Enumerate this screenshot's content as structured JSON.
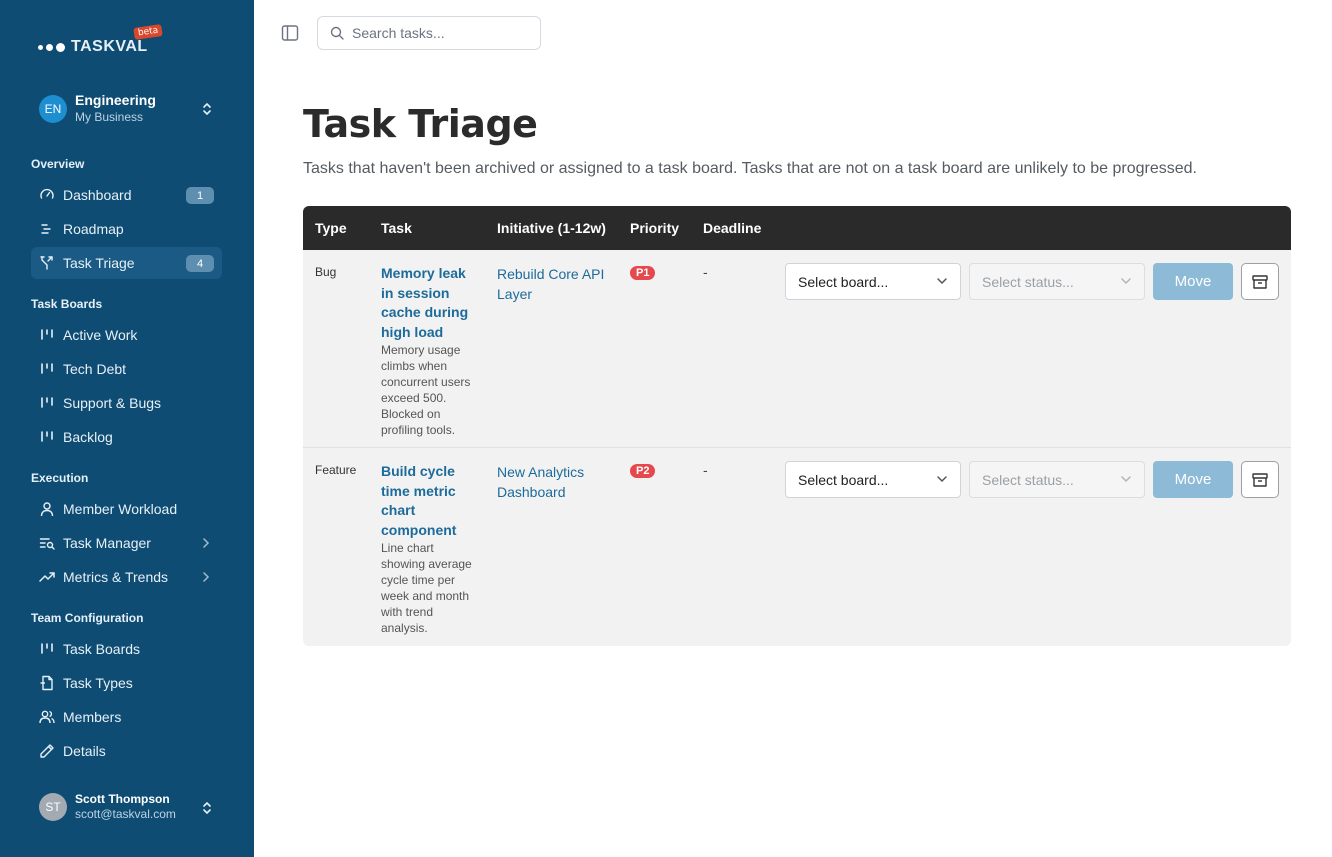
{
  "brand": {
    "name": "TASKVAL",
    "badge": "beta",
    "badge_color": "#d9482b"
  },
  "colors": {
    "sidebar_bg": "#0f4c73",
    "link": "#1d6b9a",
    "priority_red": "#e5484d",
    "move_button": "#8dbad6"
  },
  "org": {
    "initials": "EN",
    "name": "Engineering",
    "subtitle": "My Business"
  },
  "sidebar": {
    "overview": {
      "title": "Overview",
      "items": [
        {
          "label": "Dashboard",
          "icon": "gauge-icon",
          "badge": "1"
        },
        {
          "label": "Roadmap",
          "icon": "roadmap-icon"
        },
        {
          "label": "Task Triage",
          "icon": "split-icon",
          "badge": "4",
          "active": true
        }
      ]
    },
    "boards": {
      "title": "Task Boards",
      "items": [
        {
          "label": "Active Work",
          "icon": "board-icon"
        },
        {
          "label": "Tech Debt",
          "icon": "board-icon"
        },
        {
          "label": "Support & Bugs",
          "icon": "board-icon"
        },
        {
          "label": "Backlog",
          "icon": "board-icon"
        }
      ]
    },
    "execution": {
      "title": "Execution",
      "items": [
        {
          "label": "Member Workload",
          "icon": "user-icon"
        },
        {
          "label": "Task Manager",
          "icon": "list-search-icon"
        },
        {
          "label": "Metrics & Trends",
          "icon": "trend-icon"
        }
      ]
    },
    "config": {
      "title": "Team Configuration",
      "items": [
        {
          "label": "Task Boards",
          "icon": "board-icon"
        },
        {
          "label": "Task Types",
          "icon": "file-icon"
        },
        {
          "label": "Members",
          "icon": "users-icon"
        },
        {
          "label": "Details",
          "icon": "pencil-icon"
        }
      ]
    }
  },
  "user": {
    "initials": "ST",
    "name": "Scott Thompson",
    "email": "scott@taskval.com"
  },
  "search": {
    "placeholder": "Search tasks..."
  },
  "page": {
    "title": "Task Triage",
    "subtitle": "Tasks that haven't been archived or assigned to a task board. Tasks that are not on a task board are unlikely to be progressed."
  },
  "table": {
    "headers": [
      "Type",
      "Task",
      "Initiative (1-12w)",
      "Priority",
      "Deadline"
    ],
    "rows": [
      {
        "type": "Bug",
        "title": "Memory leak in session cache during high load",
        "description": "Memory usage climbs when concurrent users exceed 500. Blocked on profiling tools.",
        "initiative": "Rebuild Core API Layer",
        "priority": "P1",
        "deadline": "-",
        "board_placeholder": "Select board...",
        "status_placeholder": "Select status...",
        "move_label": "Move"
      },
      {
        "type": "Feature",
        "title": "Build cycle time metric chart component",
        "description": "Line chart showing average cycle time per week and month with trend analysis.",
        "initiative": "New Analytics Dashboard",
        "priority": "P2",
        "deadline": "-",
        "board_placeholder": "Select board...",
        "status_placeholder": "Select status...",
        "move_label": "Move"
      }
    ]
  }
}
